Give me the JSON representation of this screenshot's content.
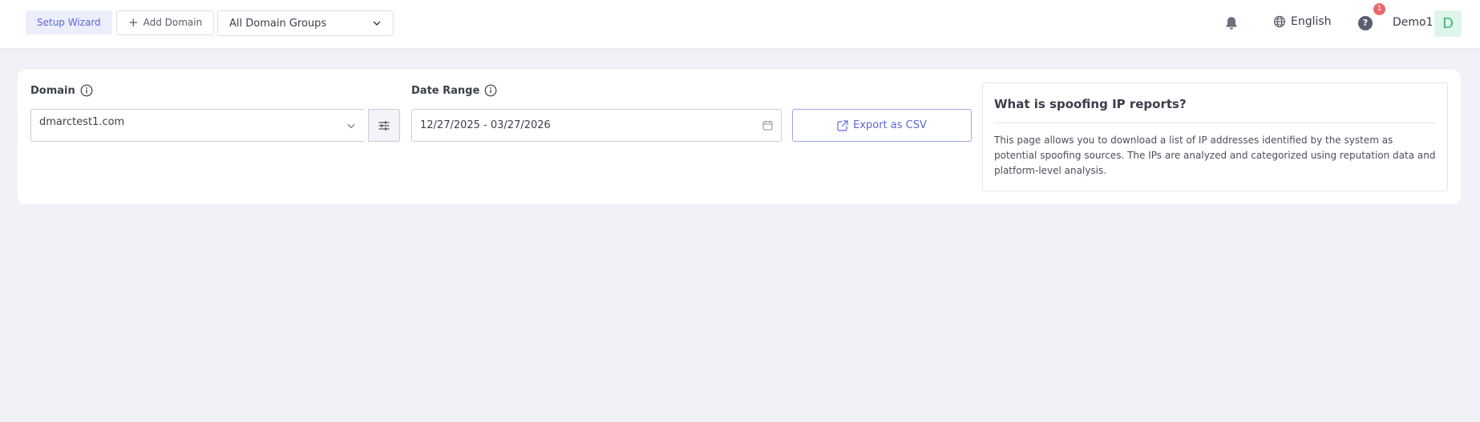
{
  "topbar": {
    "setup_wizard": "Setup Wizard",
    "add_domain": "Add Domain",
    "domain_groups_selected": "All Domain Groups",
    "language": "English",
    "notification_count": "1",
    "help": "?",
    "user_name": "Demo1",
    "avatar_initial": "D"
  },
  "form": {
    "domain_label": "Domain",
    "domain_value": "dmarctest1.com",
    "date_range_label": "Date Range",
    "date_range_value": "12/27/2025 - 03/27/2026",
    "export_label": "Export as CSV"
  },
  "info": {
    "title": "What is spoofing IP reports?",
    "text": "This page allows you to download a list of IP addresses identified by the system as potential spoofing sources. The IPs are analyzed and categorized using reputation data and platform-level analysis."
  },
  "colors": {
    "accent": "#5c67d6",
    "background": "#f1f2f7",
    "badge": "#e86a6a",
    "avatar_bg": "#dff5ea",
    "avatar_fg": "#35b779"
  },
  "icons": {
    "add": "plus-icon",
    "dropdown": "chevron-down-icon",
    "notifications": "bell-icon",
    "language": "globe-icon",
    "help": "question-icon",
    "info": "info-icon",
    "filter": "sliders-icon",
    "calendar": "calendar-icon",
    "export": "external-link-icon"
  }
}
